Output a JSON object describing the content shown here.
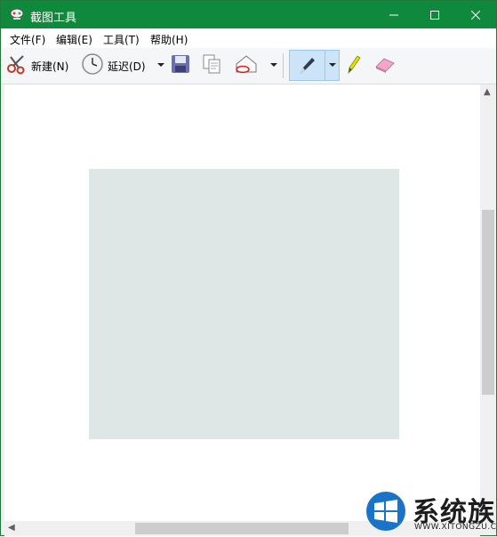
{
  "window": {
    "title": "截图工具"
  },
  "menu": {
    "file": "文件(F)",
    "edit": "编辑(E)",
    "tools": "工具(T)",
    "help": "帮助(H)"
  },
  "toolbar": {
    "new_label": "新建(N)",
    "delay_label": "延迟(D)"
  },
  "colors": {
    "titlebar": "#0f8a3c",
    "snip_fill": "#dfe6e6",
    "pen_active": "#cce4f7"
  },
  "icons": [
    "app-scissors-icon",
    "minimize-icon",
    "maximize-icon",
    "close-icon",
    "scissors-icon",
    "clock-icon",
    "save-icon",
    "copy-icon",
    "send-email-icon",
    "pen-icon",
    "highlighter-icon",
    "eraser-icon",
    "windows-logo-icon"
  ],
  "watermark": {
    "text": "系统族",
    "subtext": "WWW.XITONGZU.COM"
  }
}
